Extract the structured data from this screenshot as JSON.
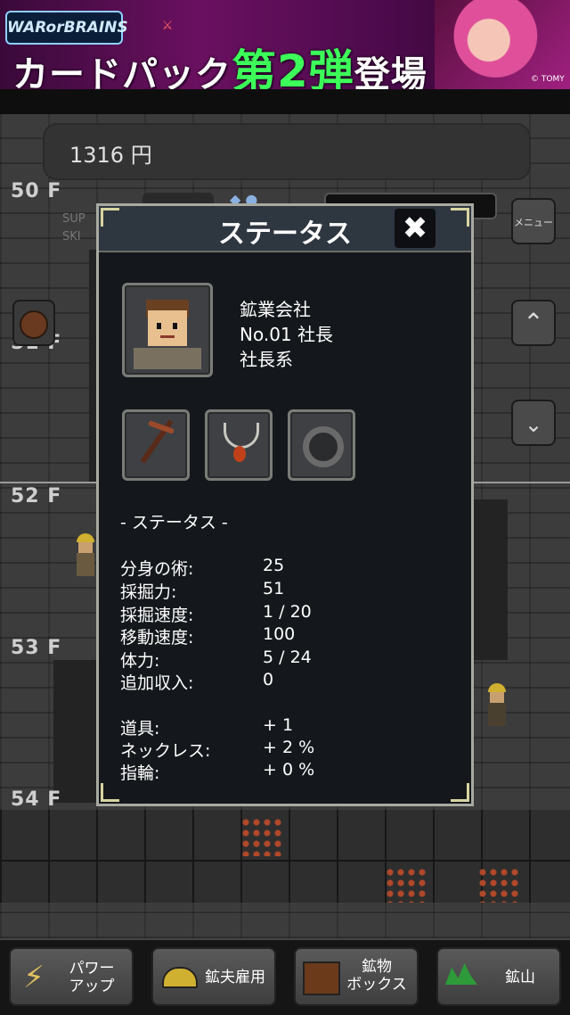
{
  "ad": {
    "logo_left": "WARorBRAINS",
    "headline_pre": "カードパック",
    "headline_hi": "第2弾",
    "headline_post": "登場",
    "copyright": "© TOMY"
  },
  "money": {
    "amount": "1316 円"
  },
  "floors": [
    "50 F",
    "51 F",
    "52 F",
    "53 F",
    "54 F"
  ],
  "side": {
    "menu_label": "メニュー",
    "sup_text": "SUP",
    "ski_text": "SKI"
  },
  "modal": {
    "title": "ステータス",
    "close_glyph": "✖",
    "company": "鉱業会社",
    "rank": "No.01 社長",
    "class": "社長系",
    "section_header": "- ステータス -",
    "stats": [
      {
        "k": "分身の術:",
        "v": "25"
      },
      {
        "k": "採掘力:",
        "v": "51"
      },
      {
        "k": "採掘速度:",
        "v": "1 / 20"
      },
      {
        "k": "移動速度:",
        "v": "100"
      },
      {
        "k": "体力:",
        "v": "5 / 24"
      },
      {
        "k": "追加収入:",
        "v": "0"
      }
    ],
    "bonuses": [
      {
        "k": "道具:",
        "v": "+ 1"
      },
      {
        "k": "ネックレス:",
        "v": "+ 2 %"
      },
      {
        "k": "指輪:",
        "v": "+ 0 %"
      }
    ]
  },
  "nav": {
    "power": "パワー\nアップ",
    "hire": "鉱夫雇用",
    "box": "鉱物\nボックス",
    "mine": "鉱山"
  },
  "colors": {
    "modal_bg": "#14181c",
    "accent_green": "#3dff5a",
    "ore": "#b0482a"
  }
}
